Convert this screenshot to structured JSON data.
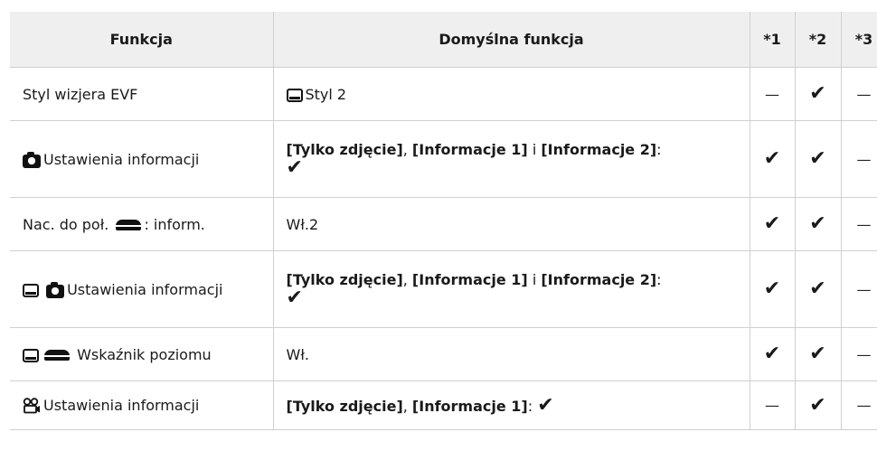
{
  "header": {
    "col1": "Funkcja",
    "col2": "Domyślna funkcja",
    "col3": "*1",
    "col4": "*2",
    "col5": "*3"
  },
  "symbols": {
    "check": "✔",
    "dash": "—"
  },
  "rows": [
    {
      "function": "Styl wizjera EVF",
      "default": "Styl 2",
      "m1": "—",
      "m2": "✔",
      "m3": "—"
    },
    {
      "function": "Ustawienia informacji",
      "default_b1": "[Tylko zdjęcie]",
      "default_sep1": ", ",
      "default_b2": "[Informacje 1]",
      "default_sep2": " i ",
      "default_b3": "[Informacje 2]",
      "default_end": ":",
      "default_check": "✔",
      "m1": "✔",
      "m2": "✔",
      "m3": "—"
    },
    {
      "function_prefix": "Nac. do poł. ",
      "function_suffix": ": inform.",
      "default": "Wł.2",
      "m1": "✔",
      "m2": "✔",
      "m3": "—"
    },
    {
      "function": "Ustawienia informacji",
      "default_b1": "[Tylko zdjęcie]",
      "default_sep1": ", ",
      "default_b2": "[Informacje 1]",
      "default_sep2": " i ",
      "default_b3": "[Informacje 2]",
      "default_end": ":",
      "default_check": "✔",
      "m1": "✔",
      "m2": "✔",
      "m3": "—"
    },
    {
      "function": " Wskaźnik poziomu",
      "default": "Wł.",
      "m1": "✔",
      "m2": "✔",
      "m3": "—"
    },
    {
      "function": "Ustawienia informacji",
      "default_b1": "[Tylko zdjęcie]",
      "default_sep1": ", ",
      "default_b2": "[Informacje 1]",
      "default_end": ":",
      "default_check": "✔",
      "m1": "—",
      "m2": "✔",
      "m3": "—"
    }
  ]
}
